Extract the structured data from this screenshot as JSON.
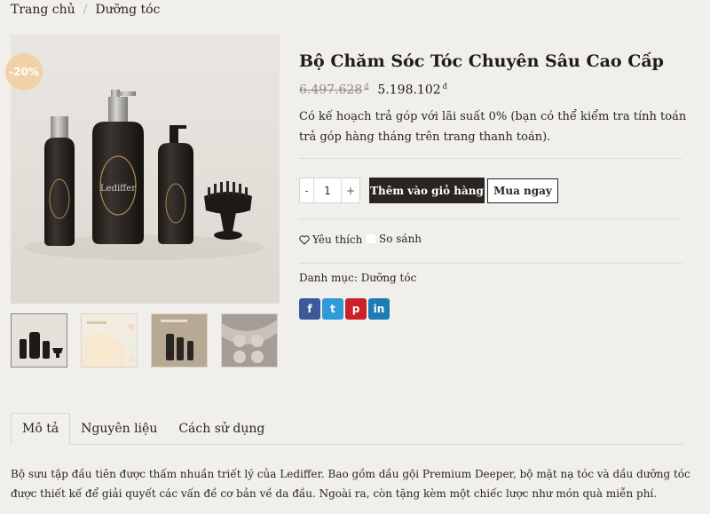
{
  "breadcrumb": {
    "home": "Trang chủ",
    "separator": "/",
    "current": "Dưỡng tóc"
  },
  "gallery": {
    "discount_badge": "-20%",
    "brand_text": "Lediffer",
    "thumbnail_count": 4
  },
  "product": {
    "title": "Bộ Chăm Sóc Tóc Chuyên Sâu Cao Cấp",
    "old_price": "6.497.628",
    "new_price": "5.198.102",
    "currency": "đ",
    "installment_text": "Có kế hoạch trả góp với lãi suất 0% (bạn có thể kiểm tra tính toán trả góp hàng tháng trên trang thanh toán)."
  },
  "cart": {
    "minus": "-",
    "quantity": "1",
    "plus": "+",
    "add_to_cart": "Thêm vào giỏ hàng",
    "buy_now": "Mua ngay"
  },
  "actions": {
    "wishlist": "Yêu thích",
    "compare": "So sánh"
  },
  "category": {
    "label": "Danh mục:",
    "value": "Dưỡng tóc"
  },
  "share": [
    {
      "name": "facebook-icon",
      "glyph": "f",
      "color": "#3a5a98"
    },
    {
      "name": "twitter-icon",
      "glyph": "t",
      "color": "#2f9ad8"
    },
    {
      "name": "pinterest-icon",
      "glyph": "p",
      "color": "#cd2129"
    },
    {
      "name": "linkedin-icon",
      "glyph": "in",
      "color": "#1f7bb5"
    }
  ],
  "tabs": [
    {
      "label": "Mô tả",
      "active": true
    },
    {
      "label": "Nguyên liệu",
      "active": false
    },
    {
      "label": "Cách sử dụng",
      "active": false
    }
  ],
  "description": "Bộ sưu tập đầu tiên được thấm nhuần triết lý của Lediffer. Bao gồm dầu gội Premium Deeper, bộ mặt nạ tóc và dầu dưỡng tóc được thiết kế để giải quyết các vấn đề cơ bản về da đầu. Ngoài ra, còn tặng kèm một chiếc lược như món quà miễn phí."
}
